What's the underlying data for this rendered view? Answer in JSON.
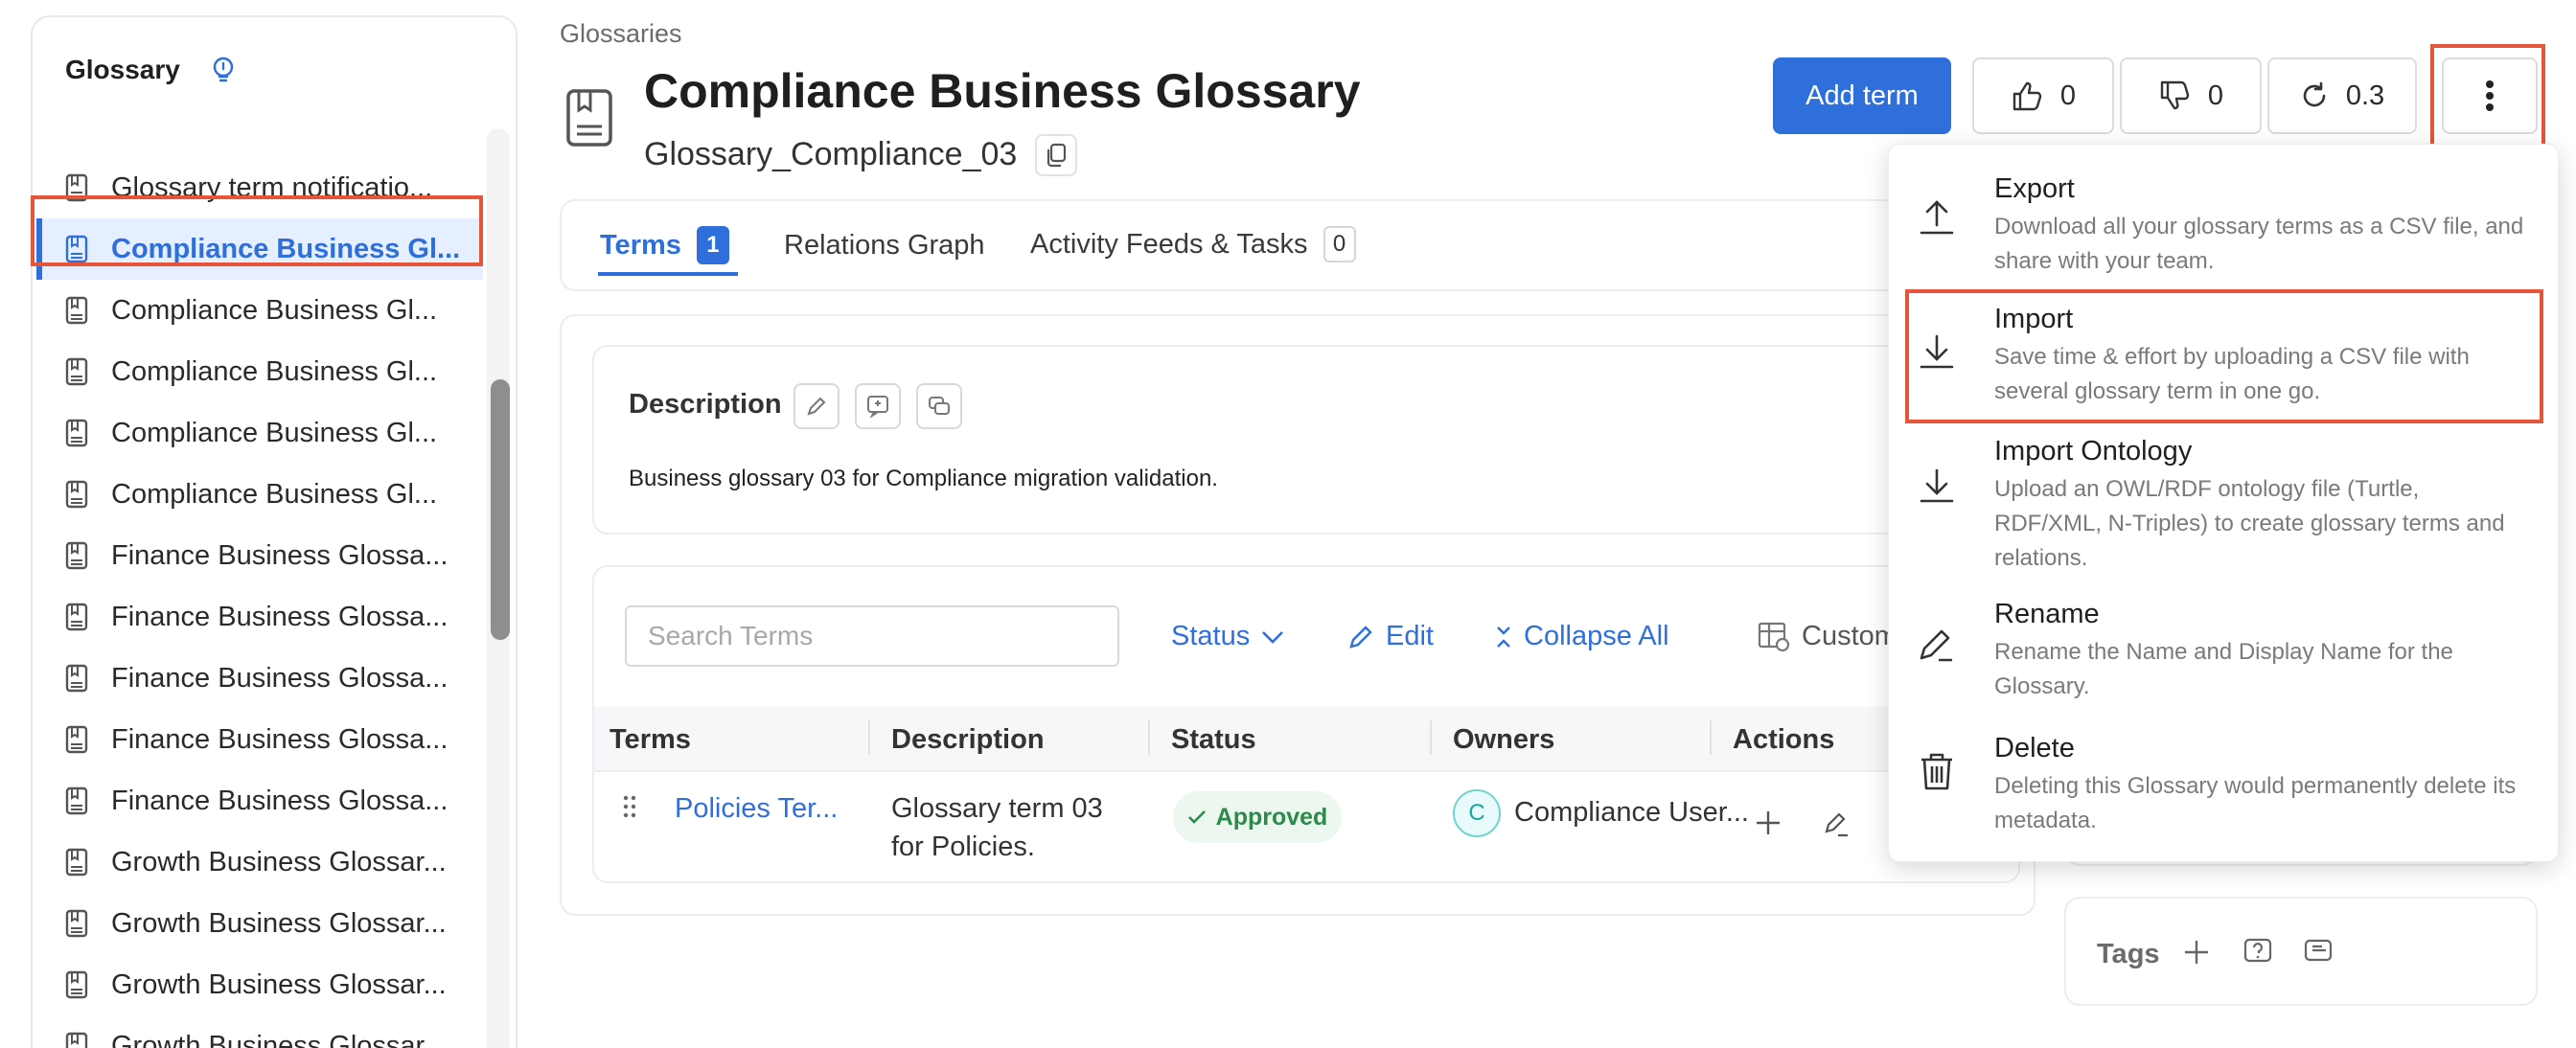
{
  "sidebar": {
    "title": "Glossary",
    "items": [
      {
        "label": "Glossary term notificatio..."
      },
      {
        "label": "Compliance Business Gl...",
        "active": true
      },
      {
        "label": "Compliance Business Gl..."
      },
      {
        "label": "Compliance Business Gl..."
      },
      {
        "label": "Compliance Business Gl..."
      },
      {
        "label": "Compliance Business Gl..."
      },
      {
        "label": "Finance Business Glossa..."
      },
      {
        "label": "Finance Business Glossa..."
      },
      {
        "label": "Finance Business Glossa..."
      },
      {
        "label": "Finance Business Glossa..."
      },
      {
        "label": "Finance Business Glossa..."
      },
      {
        "label": "Growth Business Glossar..."
      },
      {
        "label": "Growth Business Glossar..."
      },
      {
        "label": "Growth Business Glossar..."
      },
      {
        "label": "Growth Business Glossar..."
      }
    ]
  },
  "header": {
    "breadcrumb": "Glossaries",
    "title": "Compliance Business Glossary",
    "subtitle": "Glossary_Compliance_03",
    "add_term": "Add term",
    "likes": "0",
    "dislikes": "0",
    "version": "0.3"
  },
  "tabs": [
    {
      "label": "Terms",
      "count": "1"
    },
    {
      "label": "Relations Graph"
    },
    {
      "label": "Activity Feeds & Tasks",
      "count": "0"
    }
  ],
  "description": {
    "title": "Description",
    "text": "Business glossary 03 for Compliance migration validation."
  },
  "terms_toolbar": {
    "search_placeholder": "Search Terms",
    "status": "Status",
    "edit": "Edit",
    "collapse_all": "Collapse All",
    "customize": "Custom"
  },
  "table": {
    "columns": [
      "Terms",
      "Description",
      "Status",
      "Owners",
      "Actions"
    ],
    "rows": [
      {
        "term": "Policies Ter...",
        "description_line1": "Glossary term 03",
        "description_line2": "for Policies.",
        "status": "Approved",
        "owner_initial": "C",
        "owner": "Compliance User..."
      }
    ]
  },
  "tags": {
    "label": "Tags"
  },
  "menu": {
    "items": [
      {
        "title": "Export",
        "desc": "Download all your glossary terms as a CSV file, and share with your team.",
        "icon": "upload-icon"
      },
      {
        "title": "Import",
        "desc": "Save time & effort by uploading a CSV file with several glossary term in one go.",
        "icon": "download-icon"
      },
      {
        "title": "Import Ontology",
        "desc": "Upload an OWL/RDF ontology file (Turtle, RDF/XML, N-Triples) to create glossary terms and relations.",
        "icon": "download-icon"
      },
      {
        "title": "Rename",
        "desc": "Rename the Name and Display Name for the Glossary.",
        "icon": "edit-icon"
      },
      {
        "title": "Delete",
        "desc": "Deleting this Glossary would permanently delete its metadata.",
        "icon": "trash-icon"
      }
    ]
  },
  "colors": {
    "accent": "#2e6fdc",
    "highlight": "#e5553a",
    "approved": "#2d8a4a"
  }
}
